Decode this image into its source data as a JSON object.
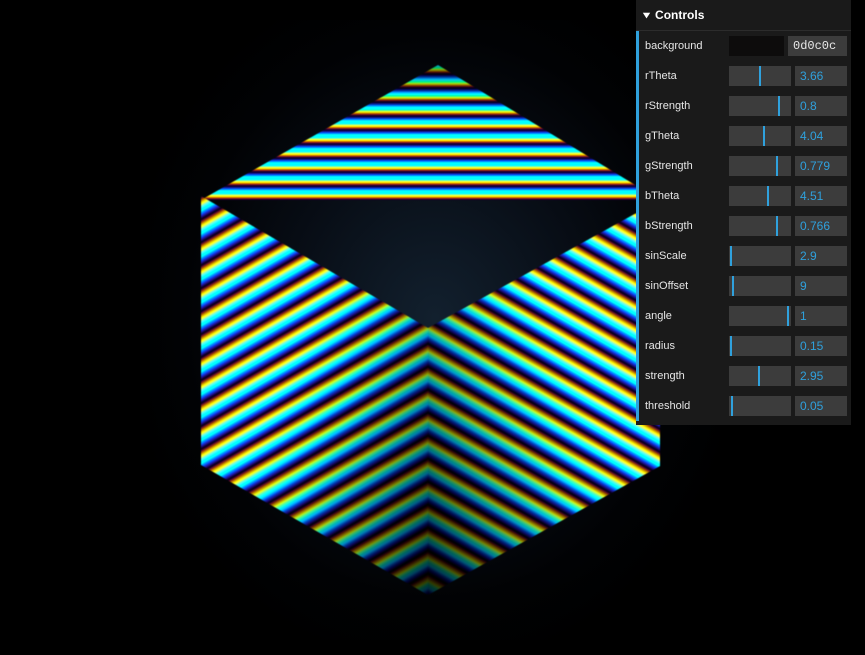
{
  "canvas": {
    "background_color": "#000000",
    "artwork_name": "neon-striped-isometric-cube",
    "faces": [
      {
        "name": "top",
        "stripe_direction": "horizontal"
      },
      {
        "name": "left",
        "stripe_direction": "diagonal-down-right"
      },
      {
        "name": "right",
        "stripe_direction": "diagonal-up-right"
      }
    ]
  },
  "panel": {
    "title": "Controls",
    "chevron_icon": "chevron-down-icon",
    "accent_color": "#2fa1dd",
    "panel_background": "#1a1a1a",
    "widget_background": "#3c3c3c",
    "label_color": "#e6e6e6",
    "rows": [
      {
        "label": "background",
        "type": "color",
        "value": "0d0c0c",
        "swatch_color": "#0d0c0c"
      },
      {
        "label": "rTheta",
        "type": "slider",
        "value": "3.66",
        "handle_pct": 50
      },
      {
        "label": "rStrength",
        "type": "slider",
        "value": "0.8",
        "handle_pct": 80
      },
      {
        "label": "gTheta",
        "type": "slider",
        "value": "4.04",
        "handle_pct": 56
      },
      {
        "label": "gStrength",
        "type": "slider",
        "value": "0.779",
        "handle_pct": 78
      },
      {
        "label": "bTheta",
        "type": "slider",
        "value": "4.51",
        "handle_pct": 63
      },
      {
        "label": "bStrength",
        "type": "slider",
        "value": "0.766",
        "handle_pct": 77
      },
      {
        "label": "sinScale",
        "type": "slider",
        "value": "2.9",
        "handle_pct": 3
      },
      {
        "label": "sinOffset",
        "type": "slider",
        "value": "9",
        "handle_pct": 7
      },
      {
        "label": "angle",
        "type": "slider",
        "value": "1",
        "handle_pct": 95
      },
      {
        "label": "radius",
        "type": "slider",
        "value": "0.15",
        "handle_pct": 3
      },
      {
        "label": "strength",
        "type": "slider",
        "value": "2.95",
        "handle_pct": 49
      },
      {
        "label": "threshold",
        "type": "slider",
        "value": "0.05",
        "handle_pct": 5
      }
    ]
  }
}
